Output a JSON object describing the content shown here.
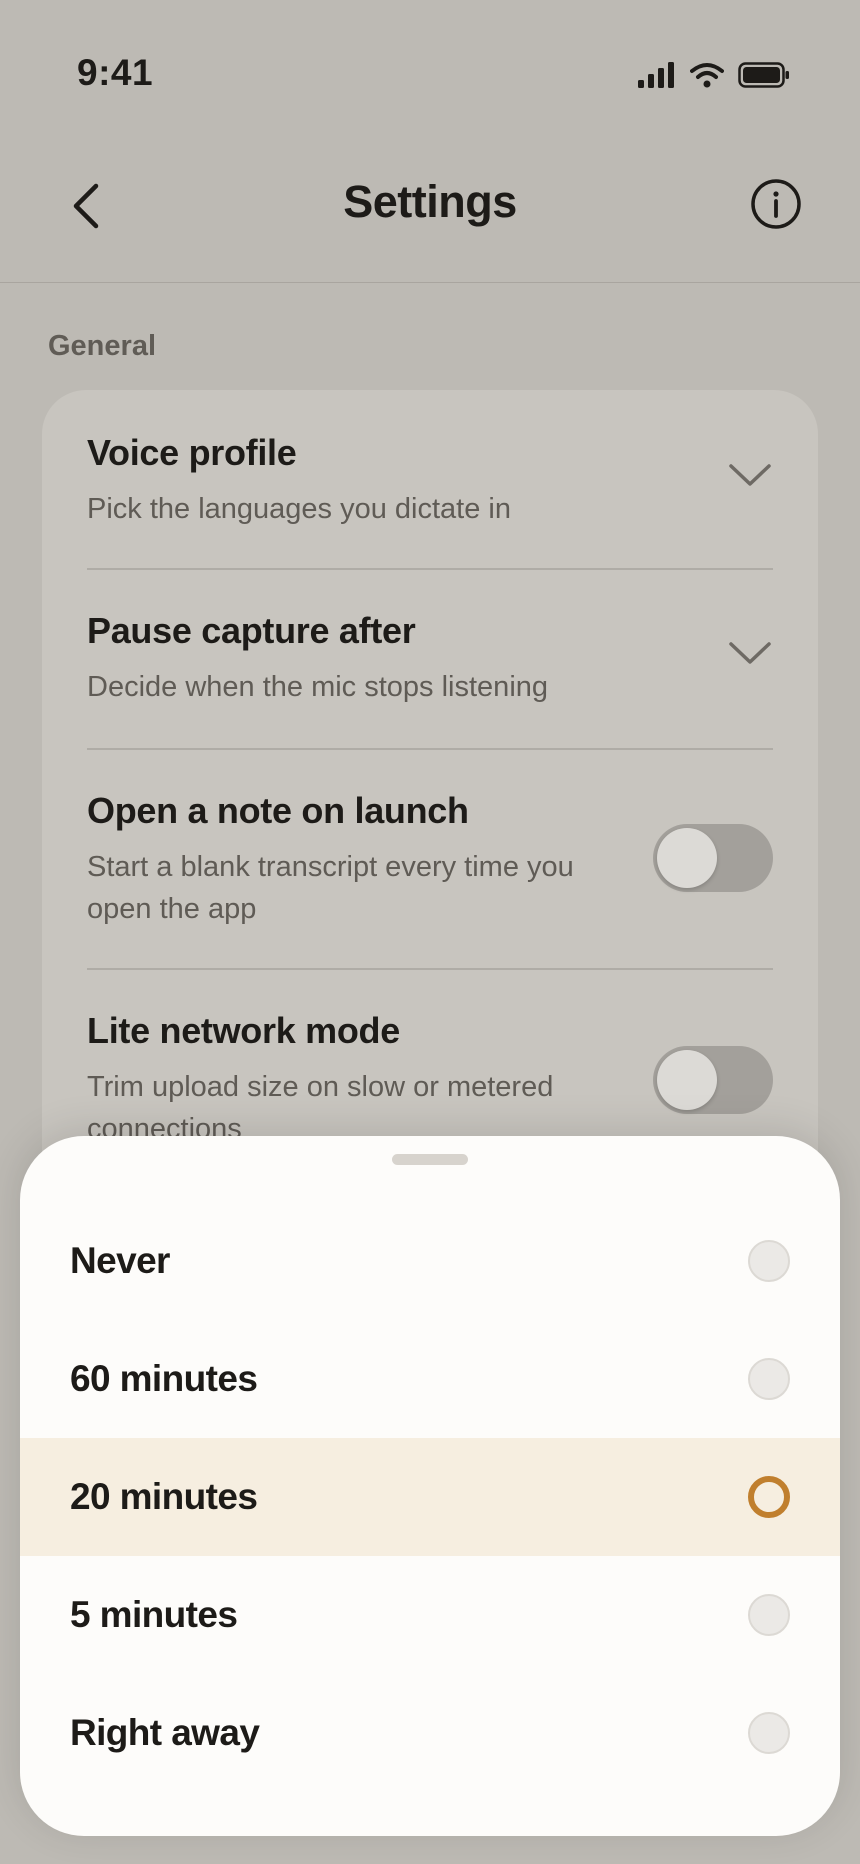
{
  "status_bar": {
    "time": "9:41",
    "icons": [
      "signal-icon",
      "wifi-icon",
      "battery-icon"
    ]
  },
  "header": {
    "title": "Settings",
    "back_icon": "chevron-left-icon",
    "info_icon": "info-icon"
  },
  "general": {
    "label": "General",
    "rows": [
      {
        "title": "Voice profile",
        "subtitle": "Pick the languages you dictate in",
        "control": "chevron-down-icon"
      },
      {
        "title": "Pause capture after",
        "subtitle": "Decide when the mic stops listening",
        "control": "chevron-down-icon"
      },
      {
        "title": "Open a note on launch",
        "subtitle_lines": [
          "Start a blank transcript every time you",
          "open the app"
        ],
        "control": "toggle",
        "on": false
      },
      {
        "title": "Lite network mode",
        "subtitle_lines": [
          "Trim upload size on slow or metered",
          "connections"
        ],
        "control": "toggle",
        "on": false
      }
    ]
  },
  "sheet": {
    "options": [
      {
        "label": "Never",
        "selected": false
      },
      {
        "label": "60 minutes",
        "selected": false
      },
      {
        "label": "20 minutes",
        "selected": true
      },
      {
        "label": "5 minutes",
        "selected": false
      },
      {
        "label": "Right away",
        "selected": false
      }
    ]
  },
  "colors": {
    "background_dimmed": "#bdbab4",
    "card": "#c8c5bf",
    "sheet": "#fdfcfa",
    "selected_row": "#f6eee0",
    "accent": "#c07f2e"
  }
}
